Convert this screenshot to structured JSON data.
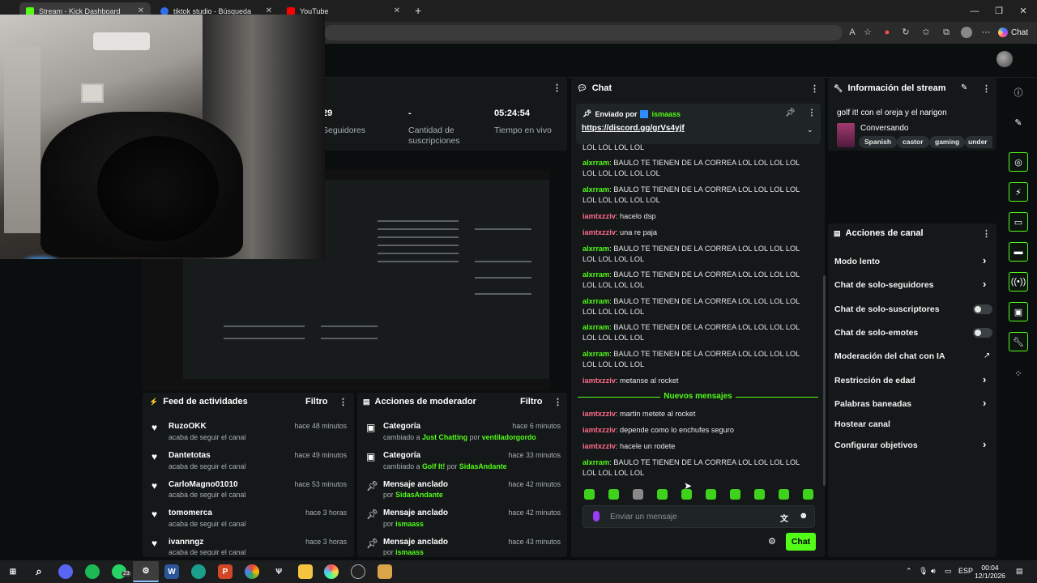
{
  "browser": {
    "tabs": [
      {
        "title": "Stream - Kick Dashboard",
        "favicon_color": "#53fc18"
      },
      {
        "title": "tiktok studio - Búsqueda",
        "favicon_color": "#2f6feb"
      },
      {
        "title": "YouTube",
        "favicon_color": "#ff0000"
      }
    ],
    "new_tab_icon": "plus-icon",
    "copilot_label": "Chat"
  },
  "stats": {
    "followers_value": "29",
    "followers_label": "Seguidores",
    "subs_value": "-",
    "subs_label_1": "Cantidad de",
    "subs_label_2": "suscripciones",
    "live_value": "05:24:54",
    "live_label": "Tiempo en vivo"
  },
  "chat": {
    "title": "Chat",
    "pinned_by_prefix": "Enviado por",
    "pinned_user": "ismaass",
    "pinned_link": "https://discord.gg/grVs4yjf",
    "messages": [
      {
        "user": "",
        "text": "LOL LOL LOL LOL",
        "color": "none"
      },
      {
        "user": "alxrram",
        "text": "BAULO TE TIENEN DE LA CORREA LOL LOL LOL LOL LOL LOL LOL LOL LOL",
        "color": "green"
      },
      {
        "user": "alxrram",
        "text": "BAULO TE TIENEN DE LA CORREA LOL LOL LOL LOL LOL LOL LOL LOL LOL",
        "color": "green"
      },
      {
        "user": "iamtxzziv",
        "text": "hacelo dsp",
        "color": "pink"
      },
      {
        "user": "iamtxzziv",
        "text": "una re paja",
        "color": "pink"
      },
      {
        "user": "alxrram",
        "text": "BAULO TE TIENEN DE LA CORREA LOL LOL LOL LOL LOL LOL LOL LOL",
        "color": "green"
      },
      {
        "user": "alxrram",
        "text": "BAULO TE TIENEN DE LA CORREA LOL LOL LOL LOL LOL LOL LOL LOL",
        "color": "green"
      },
      {
        "user": "alxrram",
        "text": "BAULO TE TIENEN DE LA CORREA LOL LOL LOL LOL LOL LOL LOL LOL",
        "color": "green"
      },
      {
        "user": "alxrram",
        "text": "BAULO TE TIENEN DE LA CORREA LOL LOL LOL LOL LOL LOL LOL LOL",
        "color": "green"
      },
      {
        "user": "alxrram",
        "text": "BAULO TE TIENEN DE LA CORREA LOL LOL LOL LOL LOL LOL LOL LOL",
        "color": "green"
      },
      {
        "user": "iamtxzziv",
        "text": "metanse al rocket",
        "color": "pink"
      }
    ],
    "new_messages_label": "Nuevos mensajes",
    "new_messages": [
      {
        "user": "iamtxzziv",
        "text": "martin metete al rocket",
        "color": "pink"
      },
      {
        "user": "iamtxzziv",
        "text": "depende como lo enchufes seguro",
        "color": "pink"
      },
      {
        "user": "iamtxzziv",
        "text": "hacele un rodete",
        "color": "pink"
      },
      {
        "user": "alxrram",
        "text": "BAULO TE TIENEN DE LA CORREA LOL LOL LOL LOL LOL LOL LOL LOL",
        "color": "green"
      }
    ],
    "input_placeholder": "Enviar un mensaje",
    "send_label": "Chat"
  },
  "stream_info": {
    "title": "Información del stream",
    "stream_title": "golf it! con el oreja y el narigon",
    "category": "Conversando",
    "tags": [
      "Spanish",
      "castor",
      "gaming",
      "under"
    ]
  },
  "channel_actions": {
    "title": "Acciones de canal",
    "items": [
      {
        "label": "Modo lento",
        "control": "chevron"
      },
      {
        "label": "Chat de solo-seguidores",
        "control": "chevron"
      },
      {
        "label": "Chat de solo-suscriptores",
        "control": "toggle"
      },
      {
        "label": "Chat de solo-emotes",
        "control": "toggle"
      },
      {
        "label": "Moderación del chat con IA",
        "control": "external"
      },
      {
        "label": "Restricción de edad",
        "control": "chevron"
      },
      {
        "label": "Palabras baneadas",
        "control": "chevron"
      },
      {
        "label": "Hostear canal",
        "control": "none"
      },
      {
        "label": "Configurar objetivos",
        "control": "chevron"
      }
    ]
  },
  "activity_feed": {
    "title": "Feed de actividades",
    "filter_label": "Filtro",
    "items": [
      {
        "name": "RuzoOKK",
        "sub": "acaba de seguir el canal",
        "time": "hace 48 minutos"
      },
      {
        "name": "Dantetotas",
        "sub": "acaba de seguir el canal",
        "time": "hace 49 minutos"
      },
      {
        "name": "CarloMagno01010",
        "sub": "acaba de seguir el canal",
        "time": "hace 53 minutos"
      },
      {
        "name": "tomomerca",
        "sub": "acaba de seguir el canal",
        "time": "hace 3 horas"
      },
      {
        "name": "ivannngz",
        "sub": "acaba de seguir el canal",
        "time": "hace 3 horas"
      }
    ]
  },
  "mod_actions": {
    "title": "Acciones de moderador",
    "filter_label": "Filtro",
    "items": [
      {
        "name": "Categoría",
        "pre": "cambiado a",
        "hl1": "Just Chatting",
        "mid": "por",
        "hl2": "ventiladorgordo",
        "time": "hace 6 minutos",
        "icon": "category-icon"
      },
      {
        "name": "Categoría",
        "pre": "cambiado a",
        "hl1": "Golf It!",
        "mid": "por",
        "hl2": "SidasAndante",
        "time": "hace 33 minutos",
        "icon": "category-icon"
      },
      {
        "name": "Mensaje anclado",
        "pre": "por",
        "hl1": "SidasAndante",
        "mid": "",
        "hl2": "",
        "time": "hace 42 minutos",
        "icon": "pin-icon"
      },
      {
        "name": "Mensaje anclado",
        "pre": "por",
        "hl1": "ismaass",
        "mid": "",
        "hl2": "",
        "time": "hace 42 minutos",
        "icon": "pin-icon"
      },
      {
        "name": "Mensaje anclado",
        "pre": "por",
        "hl1": "ismaass",
        "mid": "",
        "hl2": "",
        "time": "hace 43 minutos",
        "icon": "pin-icon"
      }
    ]
  },
  "taskbar": {
    "lang": "ESP",
    "time": "00:04",
    "date": "12/1/2026",
    "whatsapp_badge": "23"
  },
  "colors": {
    "accent": "#53fc18",
    "username_pink": "#ff6b8b",
    "panel_bg": "#141819"
  }
}
